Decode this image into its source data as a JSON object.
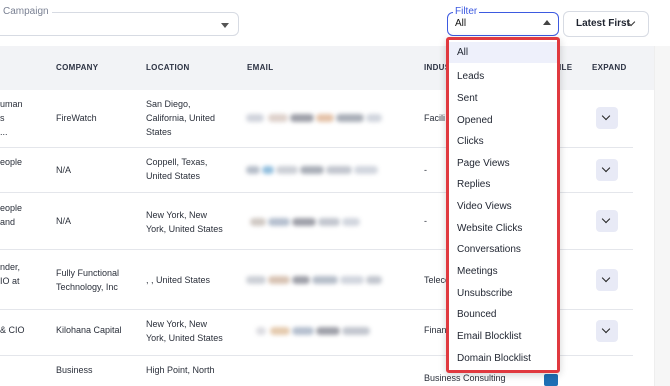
{
  "campaign": {
    "label": "Campaign"
  },
  "filter": {
    "label": "Filter",
    "value": "All",
    "options": [
      "All",
      "Leads",
      "Sent",
      "Opened",
      "Clicks",
      "Page Views",
      "Replies",
      "Video Views",
      "Website Clicks",
      "Conversations",
      "Meetings",
      "Unsubscribe",
      "Bounced",
      "Email Blocklist",
      "Domain Blocklist"
    ]
  },
  "sort": {
    "label": "Latest First"
  },
  "table": {
    "headers": {
      "company": "COMPANY",
      "location": "LOCATION",
      "email": "EMAIL",
      "industry": "INDUS",
      "profile": "ILE",
      "expand": "EXPAND"
    },
    "rows": [
      {
        "title": [
          "uman",
          "s",
          "..."
        ],
        "company": [
          "FireWatch"
        ],
        "location": [
          "San Diego,",
          "California, United",
          "States"
        ],
        "industry": "Facili"
      },
      {
        "title": [
          "eople"
        ],
        "company": [
          "N/A"
        ],
        "location": [
          "Coppell, Texas,",
          "United States"
        ],
        "industry": "-"
      },
      {
        "title": [
          "eople",
          "and"
        ],
        "company": [
          "N/A"
        ],
        "location": [
          "New York, New",
          "York, United States"
        ],
        "industry": "-"
      },
      {
        "title": [
          "nder,",
          "IO at"
        ],
        "company": [
          "Fully Functional",
          "Technology, Inc"
        ],
        "location": [
          ", , United States"
        ],
        "industry": "Teleco"
      },
      {
        "title": [
          "& CIO"
        ],
        "company": [
          "Kilohana Capital"
        ],
        "location": [
          "New York, New",
          "York, United States"
        ],
        "industry": "Finan"
      },
      {
        "title": [
          ""
        ],
        "company": [
          "Business"
        ],
        "location": [
          "High Point, North"
        ],
        "industry": "Business Consulting"
      }
    ]
  },
  "colors": {
    "accent": "#3d5ae0",
    "highlight_border": "#e0393f",
    "header_bg": "#f2f3f6"
  }
}
